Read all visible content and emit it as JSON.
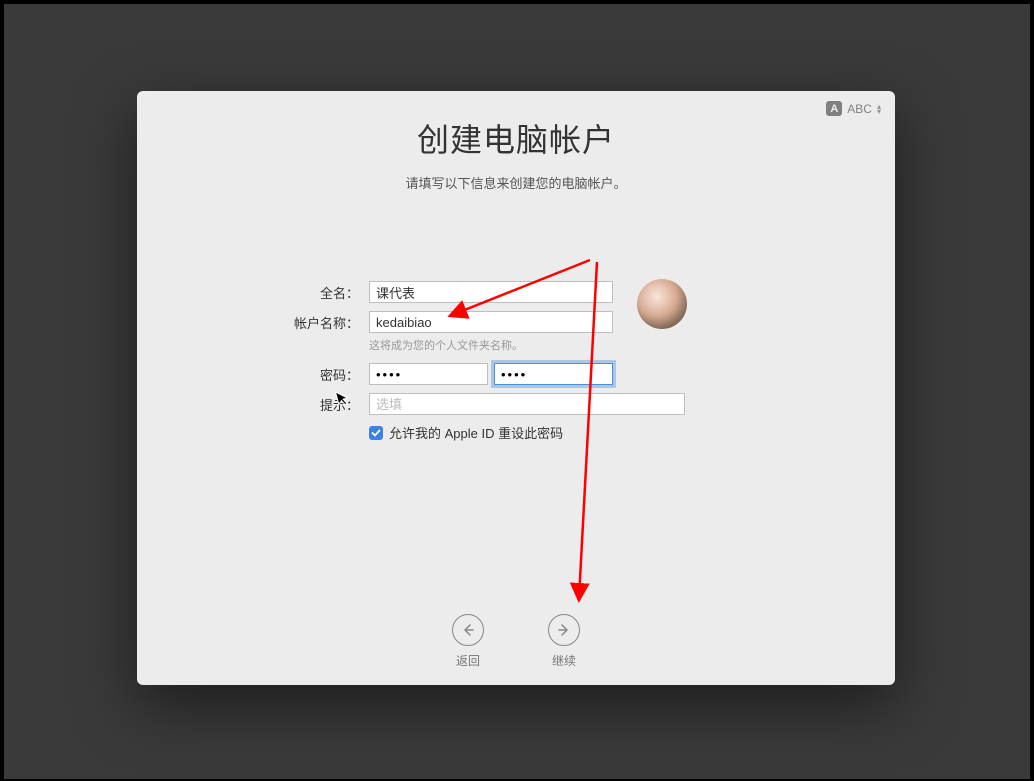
{
  "inputMethod": {
    "badge": "A",
    "label": "ABC"
  },
  "title": "创建电脑帐户",
  "subtitle": "请填写以下信息来创建您的电脑帐户。",
  "form": {
    "fullName": {
      "label": "全名：",
      "value": "课代表"
    },
    "accountName": {
      "label": "帐户名称：",
      "value": "kedaibiao",
      "hint": "这将成为您的个人文件夹名称。"
    },
    "password": {
      "label": "密码：",
      "value": "••••",
      "confirmValue": "••••"
    },
    "hint": {
      "label": "提示：",
      "placeholder": "选填"
    },
    "checkbox": {
      "label": "允许我的 Apple ID 重设此密码",
      "checked": true
    }
  },
  "nav": {
    "back": "返回",
    "continue": "继续"
  }
}
